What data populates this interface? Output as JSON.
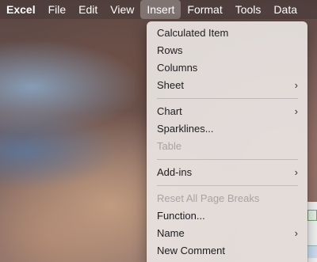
{
  "menubar": {
    "app": "Excel",
    "items": [
      "File",
      "Edit",
      "View",
      "Insert",
      "Format",
      "Tools",
      "Data"
    ],
    "active": "Insert"
  },
  "insert_menu": {
    "items": [
      {
        "label": "Calculated Item",
        "enabled": true,
        "submenu": false
      },
      {
        "label": "Rows",
        "enabled": true,
        "submenu": false
      },
      {
        "label": "Columns",
        "enabled": true,
        "submenu": false
      },
      {
        "label": "Sheet",
        "enabled": true,
        "submenu": true
      },
      {
        "label": "Chart",
        "enabled": true,
        "submenu": true
      },
      {
        "label": "Sparklines...",
        "enabled": true,
        "submenu": false
      },
      {
        "label": "Table",
        "enabled": false,
        "submenu": false
      },
      {
        "label": "Add-ins",
        "enabled": true,
        "submenu": true
      },
      {
        "label": "Reset All Page Breaks",
        "enabled": false,
        "submenu": false
      },
      {
        "label": "Function...",
        "enabled": true,
        "submenu": false
      },
      {
        "label": "Name",
        "enabled": true,
        "submenu": true
      },
      {
        "label": "New Comment",
        "enabled": true,
        "submenu": false
      }
    ],
    "chevron": "›"
  }
}
